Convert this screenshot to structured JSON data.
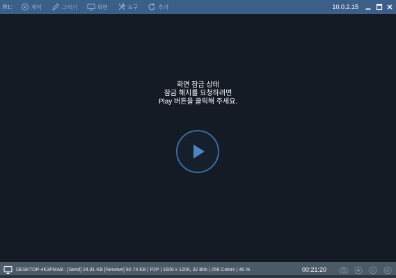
{
  "titlebar": {
    "logo": "Rt:",
    "menu": [
      {
        "label": "제어",
        "icon": "control-icon"
      },
      {
        "label": "그리기",
        "icon": "pen-icon"
      },
      {
        "label": "화면",
        "icon": "monitor-icon"
      },
      {
        "label": "도구",
        "icon": "tools-icon"
      },
      {
        "label": "추가",
        "icon": "refresh-icon"
      }
    ],
    "version": "10.0.2.15"
  },
  "main": {
    "line1": "화면 잠금 상태",
    "line2": "잠금 해지를 요청하려면",
    "line3": "Play 버튼을 클릭해 주세요."
  },
  "statusbar": {
    "info": "DESKTOP-4K3PMAB : [Send] 24.81 KB  [Receive] 92.74 KB | P2P | 1600 x 1200, 32 Bits | 256 Colors | 46 %",
    "timer": "00:21:20"
  },
  "colors": {
    "titlebar": "#3b5f88",
    "background": "#141b24",
    "statusbar": "#4a5a66",
    "play_accent": "#4f86c0"
  }
}
